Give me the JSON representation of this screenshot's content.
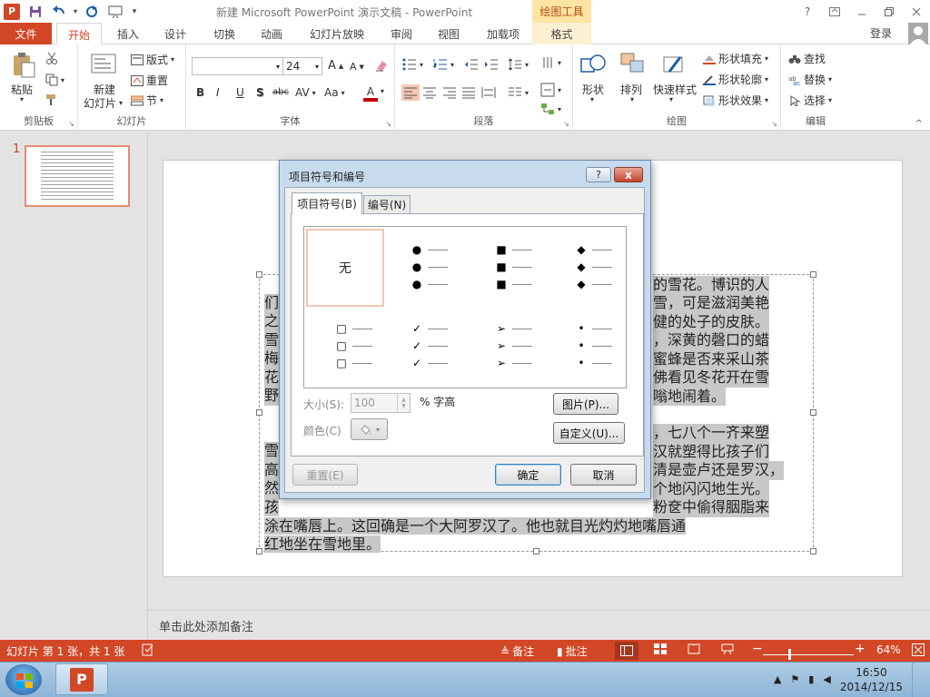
{
  "window": {
    "title": "新建 Microsoft PowerPoint 演示文稿 - PowerPoint",
    "context_tab_group": "绘图工具",
    "help": "?",
    "account": "登录",
    "logo_letter": "P"
  },
  "tabs": [
    "文件",
    "开始",
    "插入",
    "设计",
    "切换",
    "动画",
    "幻灯片放映",
    "审阅",
    "视图",
    "加载项",
    "格式"
  ],
  "ribbon": {
    "clipboard": {
      "label": "剪贴板",
      "paste": "粘贴"
    },
    "slides": {
      "label": "幻灯片",
      "new_slide_1": "新建",
      "new_slide_2": "幻灯片",
      "layout": "版式",
      "reset": "重置",
      "section": "节"
    },
    "font": {
      "label": "字体",
      "font_name": "",
      "font_size": "24",
      "bold": "B",
      "italic": "I",
      "underline": "U",
      "shadow": "S",
      "strike": "abc",
      "spacing": "AV",
      "case": "Aa",
      "color": "A",
      "grow": "A",
      "shrink": "A"
    },
    "paragraph": {
      "label": "段落"
    },
    "drawing": {
      "label": "绘图",
      "shapes": "形状",
      "arrange": "排列",
      "quick_styles": "快速样式",
      "fill": "形状填充",
      "outline": "形状轮廓",
      "effects": "形状效果"
    },
    "editing": {
      "label": "编辑",
      "find": "查找",
      "replace": "替换",
      "select": "选择"
    }
  },
  "thumbnail": {
    "number": "1"
  },
  "slide_text": {
    "lines": [
      {
        "left": "们",
        "right": "的雪花。博识的人"
      },
      {
        "left": "之",
        "right": "雪，可是滋润美艳"
      },
      {
        "left": "雪",
        "right": "健的处子的皮肤。"
      },
      {
        "left": "梅",
        "right": "，深黄的磬口的蜡"
      },
      {
        "left": "花",
        "right": "蜜蜂是否来采山茶"
      },
      {
        "left": "野",
        "right": "佛看见冬花开在雪"
      },
      {
        "left": "",
        "right": "嗡地闹着。"
      },
      {
        "left": "雪",
        "right": "，七八个一齐来塑"
      },
      {
        "left": "高",
        "right": "汉就塑得比孩子们"
      },
      {
        "left": "然",
        "right": "清是壶卢还是罗汉，"
      },
      {
        "left": "孩",
        "right": "个地闪闪地生光。"
      },
      {
        "left": "",
        "right": "粉奁中偷得胭脂来"
      }
    ],
    "last_lines": [
      "涂在嘴唇上。这回确是一个大阿罗汉了。他也就目光灼灼地嘴唇通",
      "红地坐在雪地里。"
    ]
  },
  "notes_placeholder": "单击此处添加备注",
  "status": {
    "slide_info": "幻灯片 第 1 张，共 1 张",
    "notes": "备注",
    "comments": "批注",
    "zoom": "64%",
    "zoom_level": 0.5
  },
  "taskbar": {
    "time": "16:50",
    "date": "2014/12/15"
  },
  "dialog": {
    "title": "项目符号和编号",
    "help": "?",
    "close": "x",
    "tab_bullets": "项目符号(B)",
    "tab_numbering": "编号(N)",
    "none_label": "无",
    "bullet_styles": [
      "●",
      "■",
      "◆",
      "□",
      "✓",
      "➢",
      "•"
    ],
    "size_label": "大小(S):",
    "size_value": "100",
    "size_unit": "% 字高",
    "color_label": "颜色(C)",
    "picture_btn": "图片(P)...",
    "custom_btn": "自定义(U)...",
    "reset_btn": "重置(E)",
    "ok_btn": "确定",
    "cancel_btn": "取消"
  }
}
